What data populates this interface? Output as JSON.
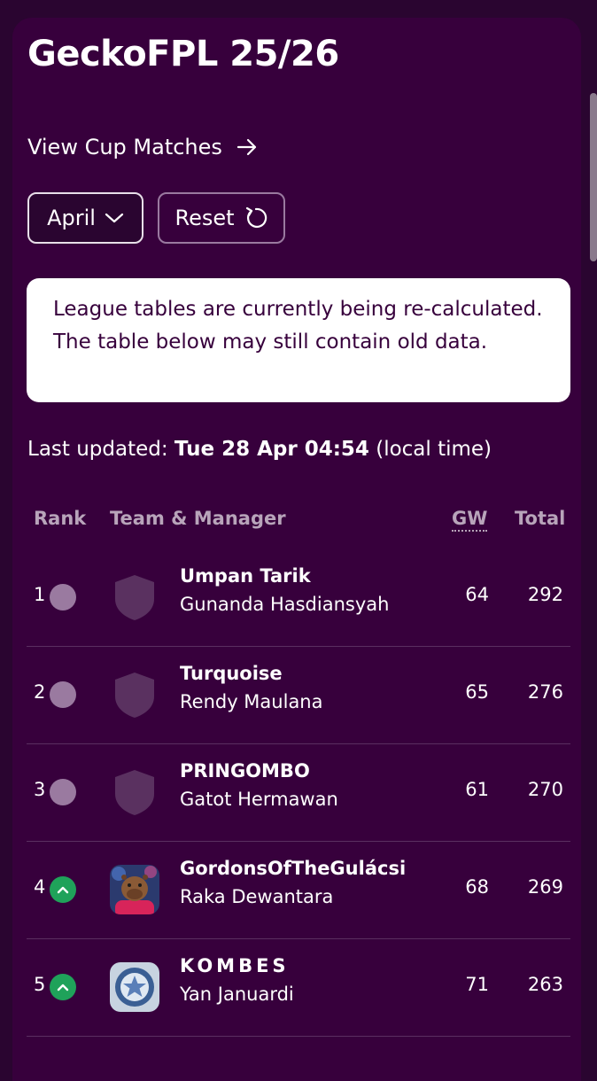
{
  "league": {
    "title": "GeckoFPL 25/26"
  },
  "cup_link": {
    "label": "View Cup Matches",
    "icon": "arrow-right-icon"
  },
  "filters": {
    "month_label": "April",
    "month_icon": "chevron-down-icon",
    "reset_label": "Reset",
    "reset_icon": "refresh-icon"
  },
  "notice": {
    "text": "League tables are currently being re-calculated. The table below may still contain old data."
  },
  "updated": {
    "prefix": "Last updated:",
    "datetime": "Tue 28 Apr 04:54",
    "suffix": "(local time)"
  },
  "table": {
    "headers": {
      "rank": "Rank",
      "team": "Team & Manager",
      "gw": "GW",
      "total": "Total"
    },
    "rows": [
      {
        "rank": "1",
        "movement": "same",
        "crest": "placeholder-shield",
        "team": "Umpan Tarik",
        "manager": "Gunanda Hasdiansyah",
        "gw": "64",
        "total": "292"
      },
      {
        "rank": "2",
        "movement": "same",
        "crest": "placeholder-shield",
        "team": "Turquoise",
        "manager": "Rendy Maulana",
        "gw": "65",
        "total": "276"
      },
      {
        "rank": "3",
        "movement": "same",
        "crest": "placeholder-shield",
        "team": "PRINGOMBO",
        "manager": "Gatot Hermawan",
        "gw": "61",
        "total": "270"
      },
      {
        "rank": "4",
        "movement": "up",
        "crest": "capybara-avatar",
        "team": "GordonsOfTheGulácsi",
        "manager": "Raka Dewantara",
        "gw": "68",
        "total": "269"
      },
      {
        "rank": "5",
        "movement": "up",
        "crest": "star-badge",
        "team": "KOMBES",
        "manager": "Yan Januardi",
        "gw": "71",
        "total": "263"
      }
    ]
  },
  "colors": {
    "background": "#37003c",
    "movement_same": "#9a7aa0",
    "movement_up": "#1fa25a",
    "notice_bg": "#ffffff"
  }
}
